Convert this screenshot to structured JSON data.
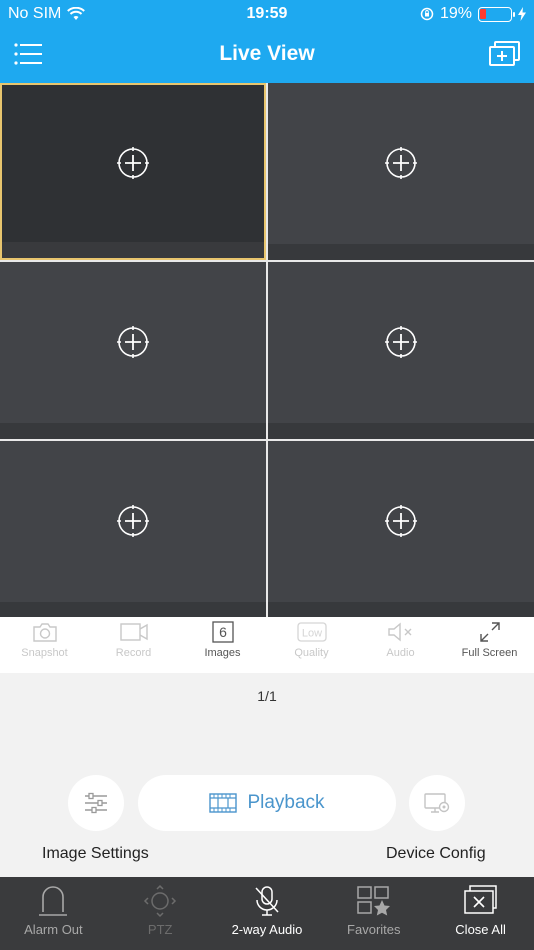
{
  "status_bar": {
    "carrier": "No SIM",
    "time": "19:59",
    "battery_percent": "19%",
    "battery_level": 0.19
  },
  "header": {
    "title": "Live View",
    "menu_icon": "hamburger-icon",
    "add_window_icon": "add-window-icon"
  },
  "grid": {
    "channels": 6,
    "selected_index": 0,
    "cell_icon": "add-camera-plus-icon"
  },
  "toolbar": {
    "snapshot": "Snapshot",
    "record": "Record",
    "images": "Images",
    "images_count": "6",
    "quality": "Quality",
    "quality_value": "Low",
    "audio": "Audio",
    "fullscreen": "Full Screen"
  },
  "page_indicator": "1/1",
  "actions": {
    "playback": "Playback",
    "image_settings": "Image Settings",
    "device_config": "Device Config"
  },
  "bottom_bar": {
    "alarm_out": "Alarm Out",
    "ptz": "PTZ",
    "two_way_audio": "2-way Audio",
    "favorites": "Favorites",
    "close_all": "Close All"
  },
  "colors": {
    "header": "#1ea9f0",
    "selected_border": "#e8c56e",
    "playback_text": "#4a95cc",
    "bottom_bar": "#3a3b3d"
  }
}
